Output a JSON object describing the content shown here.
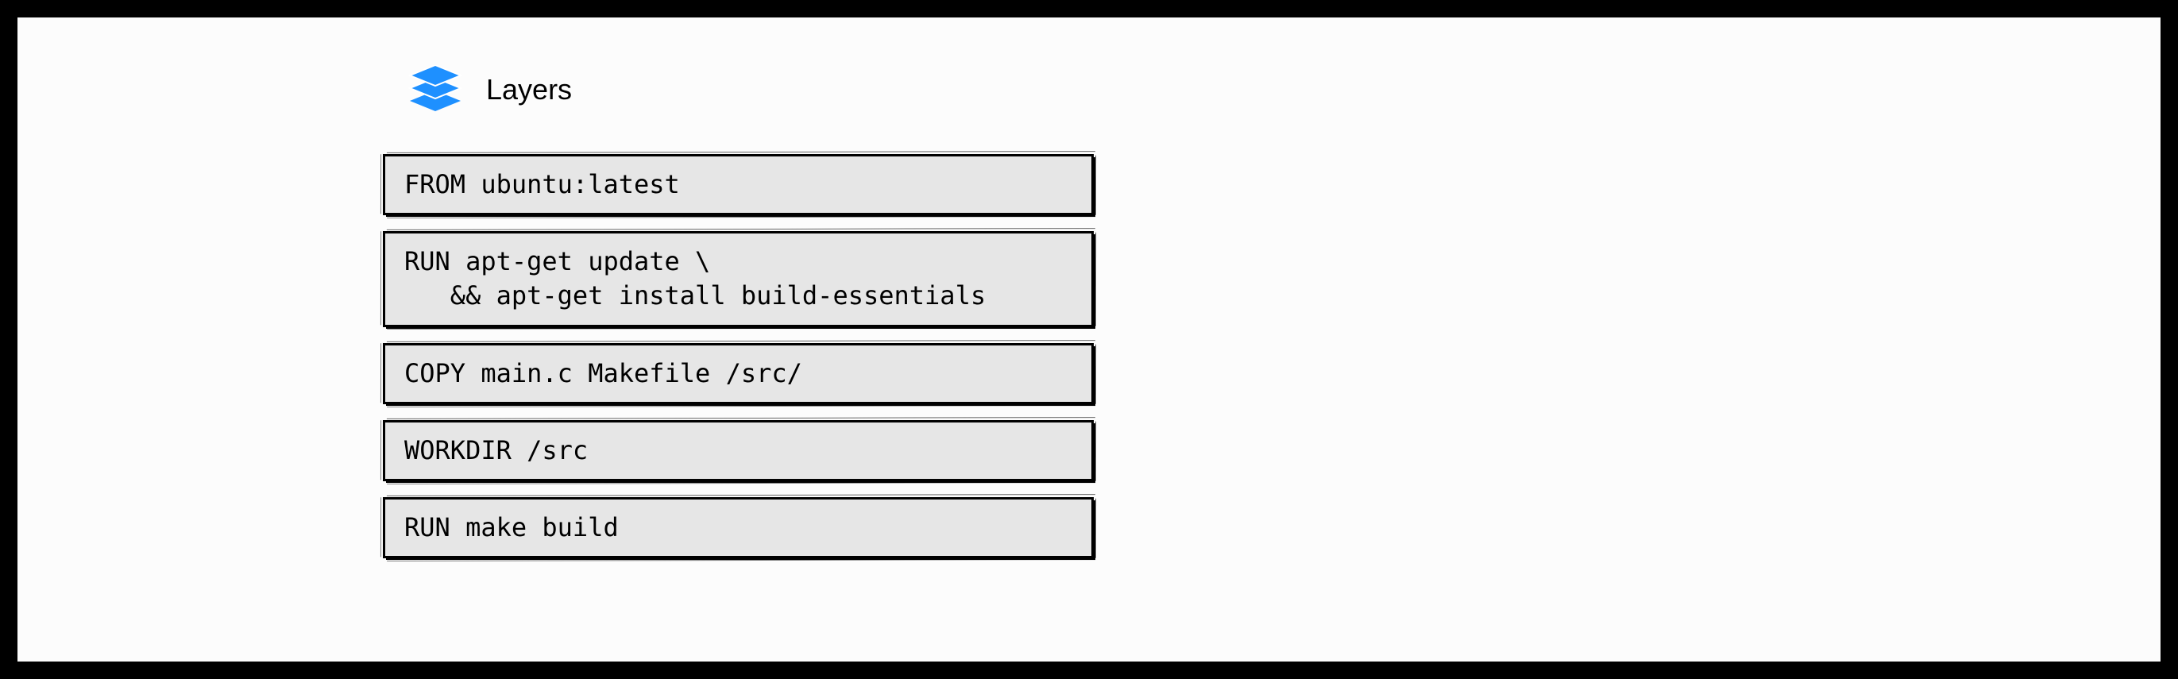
{
  "title": "Layers",
  "icon_color": "#1e90ff",
  "layers": [
    {
      "code": "FROM ubuntu:latest"
    },
    {
      "code": "RUN apt-get update \\\n   && apt-get install build-essentials"
    },
    {
      "code": "COPY main.c Makefile /src/"
    },
    {
      "code": "WORKDIR /src"
    },
    {
      "code": "RUN make build"
    }
  ]
}
